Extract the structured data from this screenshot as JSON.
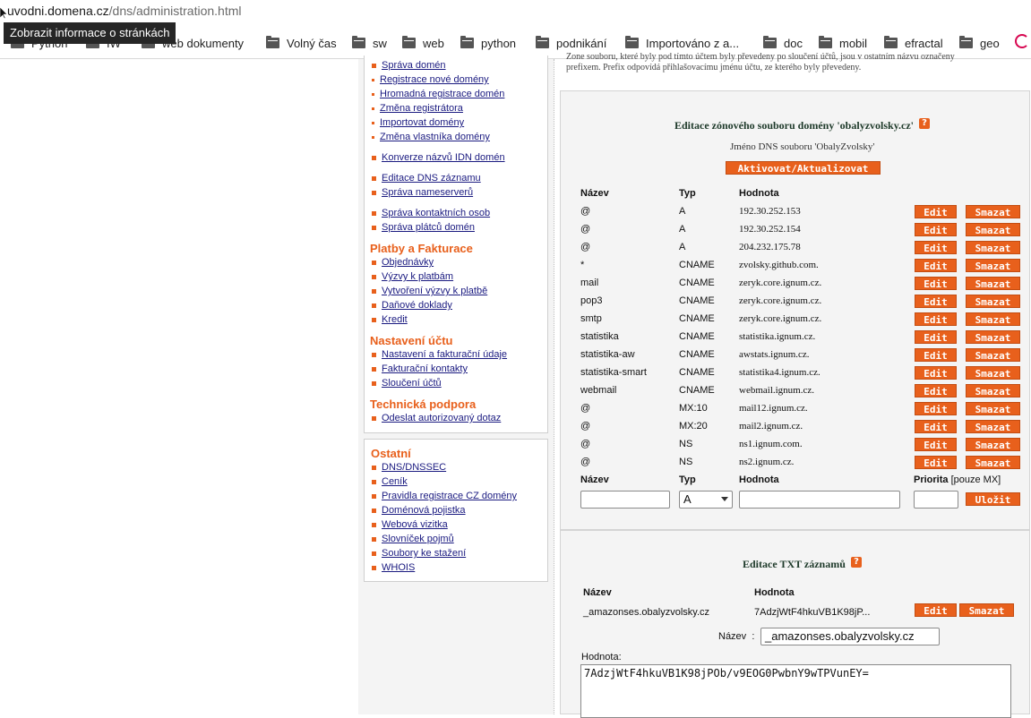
{
  "browser": {
    "url_host": "uvodni.domena.cz",
    "url_path": "/dns/administration.html",
    "tooltip": "Zobrazit informace o stránkách",
    "bookmarks": [
      {
        "label": "Python"
      },
      {
        "label": "IW"
      },
      {
        "label": "web dokumenty"
      },
      {
        "label": "Volný čas"
      },
      {
        "label": "sw"
      },
      {
        "label": "web"
      },
      {
        "label": "python"
      },
      {
        "label": "podnikání"
      },
      {
        "label": "Importováno z a..."
      },
      {
        "label": "doc"
      },
      {
        "label": "mobil"
      },
      {
        "label": "efractal"
      },
      {
        "label": "geo"
      }
    ]
  },
  "sidebar": {
    "domain_links": [
      "Správa domén",
      "Registrace nové domény",
      "Hromadná registrace domén",
      "Změna registrátora",
      "Importovat domény",
      "Změna vlastníka domény"
    ],
    "links_a": [
      "Konverze názvů IDN domén"
    ],
    "links_b": [
      "Editace DNS záznamu",
      "Správa nameserverů"
    ],
    "links_c": [
      "Správa kontaktních osob",
      "Správa plátců domén"
    ],
    "sections": [
      {
        "title": "Platby a Fakturace",
        "items": [
          "Objednávky",
          "Výzvy k platbám",
          "Vytvoření výzvy k platbě",
          "Daňové doklady",
          "Kredit"
        ]
      },
      {
        "title": "Nastavení účtu",
        "items": [
          "Nastavení a fakturační údaje",
          "Fakturační kontakty",
          "Sloučení účtů"
        ]
      },
      {
        "title": "Technická podpora",
        "items": [
          "Odeslat autorizovaný dotaz"
        ]
      }
    ],
    "other": {
      "title": "Ostatní",
      "items": [
        "DNS/DNSSEC",
        "Ceník",
        "Pravidla registrace CZ domény",
        "Doménová pojistka",
        "Webová vizitka",
        "Slovníček pojmů",
        "Soubory ke stažení",
        "WHOIS"
      ]
    }
  },
  "main": {
    "top_note_1": "Zone souboru, které byly pod tímto účtem byly převedeny po sloučení účtů, jsou v ostatním názvu označeny",
    "top_note_2": "prefixem. Prefix odpovídá přihlašovacímu jménu účtu, ze kterého byly převedeny.",
    "zone": {
      "title": "Editace zónového souboru domény 'obalyzvolsky.cz'",
      "help": "?",
      "subtitle": "Jméno DNS souboru 'ObalyZvolsky'",
      "activate_label": "Aktivovat/Aktualizovat",
      "headers": {
        "name": "Název",
        "type": "Typ",
        "value": "Hodnota"
      },
      "edit_label": "Edit",
      "delete_label": "Smazat",
      "records": [
        {
          "name": "@",
          "type": "A",
          "value": "192.30.252.153"
        },
        {
          "name": "@",
          "type": "A",
          "value": "192.30.252.154"
        },
        {
          "name": "@",
          "type": "A",
          "value": "204.232.175.78"
        },
        {
          "name": "*",
          "type": "CNAME",
          "value": "zvolsky.github.com."
        },
        {
          "name": "mail",
          "type": "CNAME",
          "value": "zeryk.core.ignum.cz."
        },
        {
          "name": "pop3",
          "type": "CNAME",
          "value": "zeryk.core.ignum.cz."
        },
        {
          "name": "smtp",
          "type": "CNAME",
          "value": "zeryk.core.ignum.cz."
        },
        {
          "name": "statistika",
          "type": "CNAME",
          "value": "statistika.ignum.cz."
        },
        {
          "name": "statistika-aw",
          "type": "CNAME",
          "value": "awstats.ignum.cz."
        },
        {
          "name": "statistika-smart",
          "type": "CNAME",
          "value": "statistika4.ignum.cz."
        },
        {
          "name": "webmail",
          "type": "CNAME",
          "value": "webmail.ignum.cz."
        },
        {
          "name": "@",
          "type": "MX:10",
          "value": "mail12.ignum.cz."
        },
        {
          "name": "@",
          "type": "MX:20",
          "value": "mail2.ignum.cz."
        },
        {
          "name": "@",
          "type": "NS",
          "value": "ns1.ignum.com."
        },
        {
          "name": "@",
          "type": "NS",
          "value": "ns2.ignum.cz."
        }
      ],
      "new_headers": {
        "name": "Název",
        "type": "Typ",
        "value": "Hodnota",
        "priority": "Priorita",
        "priority_note": "[pouze MX]"
      },
      "new_type_selected": "A",
      "save_label": "Uložit"
    },
    "txt": {
      "title": "Editace TXT záznamů",
      "help": "?",
      "headers": {
        "name": "Název",
        "value": "Hodnota"
      },
      "records": [
        {
          "name": "_amazonses.obalyzvolsky.cz",
          "value": "7AdzjWtF4hkuVB1K98jP..."
        }
      ],
      "edit_label": "Edit",
      "delete_label": "Smazat",
      "name_label": "Název",
      "name_sep": ":",
      "name_value": "_amazonses.obalyzvolsky.cz",
      "value_label": "Hodnota:",
      "value_text": "7AdzjWtF4hkuVB1K98jPOb/v9EOG0PwbnY9wTPVunEY="
    }
  }
}
